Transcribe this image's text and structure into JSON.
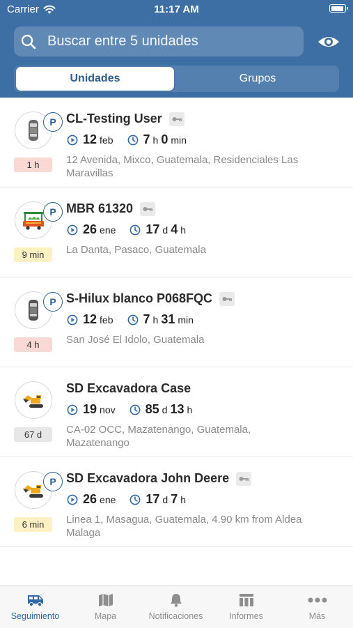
{
  "status_bar": {
    "carrier": "Carrier",
    "time": "11:17 AM"
  },
  "search": {
    "placeholder": "Buscar entre 5 unidades"
  },
  "segments": {
    "active": "Unidades",
    "inactive": "Grupos"
  },
  "colors": {
    "header": "#3d6fa5",
    "accent": "#3068a8",
    "badge_red": "#fad8d4",
    "badge_yellow": "#fdf1c4",
    "badge_gray": "#e7e7e7"
  },
  "units": [
    {
      "name": "CL-Testing User",
      "parked": "P",
      "has_key": true,
      "icon": "car-top-view-icon",
      "date_num": "12",
      "date_unit": "feb",
      "dur1_num": "7",
      "dur1_unit": "h",
      "dur2_num": "0",
      "dur2_unit": "min",
      "address": "12 Avenida, Mixco, Guatemala, Residenciales Las Maravillas",
      "badge": "1 h",
      "badge_color": "red"
    },
    {
      "name": "MBR 61320",
      "parked": "P",
      "has_key": true,
      "icon": "food-truck-icon",
      "date_num": "26",
      "date_unit": "ene",
      "dur1_num": "17",
      "dur1_unit": "d",
      "dur2_num": "4",
      "dur2_unit": "h",
      "address": "La Danta, Pasaco, Guatemala",
      "badge": "9 min",
      "badge_color": "yellow"
    },
    {
      "name": "S-Hilux blanco P068FQC",
      "parked": "P",
      "has_key": true,
      "icon": "car-top-view-icon",
      "date_num": "12",
      "date_unit": "feb",
      "dur1_num": "7",
      "dur1_unit": "h",
      "dur2_num": "31",
      "dur2_unit": "min",
      "address": "San José El Idolo, Guatemala",
      "badge": "4 h",
      "badge_color": "red"
    },
    {
      "name": "SD Excavadora Case",
      "parked": "",
      "has_key": false,
      "icon": "excavator-icon",
      "date_num": "19",
      "date_unit": "nov",
      "dur1_num": "85",
      "dur1_unit": "d",
      "dur2_num": "13",
      "dur2_unit": "h",
      "address": "CA-02 OCC, Mazatenango, Guatemala, Mazatenango",
      "badge": "67 d",
      "badge_color": "gray"
    },
    {
      "name": "SD Excavadora John Deere",
      "parked": "P",
      "has_key": true,
      "icon": "excavator-icon",
      "date_num": "26",
      "date_unit": "ene",
      "dur1_num": "17",
      "dur1_unit": "d",
      "dur2_num": "7",
      "dur2_unit": "h",
      "address": "Linea 1, Masagua, Guatemala, 4.90 km from Aldea Malaga",
      "badge": "6 min",
      "badge_color": "yellow"
    }
  ],
  "tabs": [
    {
      "label": "Seguimiento",
      "icon": "van-icon",
      "active": true
    },
    {
      "label": "Mapa",
      "icon": "map-icon",
      "active": false
    },
    {
      "label": "Notificaciones",
      "icon": "bell-icon",
      "active": false
    },
    {
      "label": "Informes",
      "icon": "table-icon",
      "active": false
    },
    {
      "label": "Más",
      "icon": "more-dots-icon",
      "active": false
    }
  ]
}
